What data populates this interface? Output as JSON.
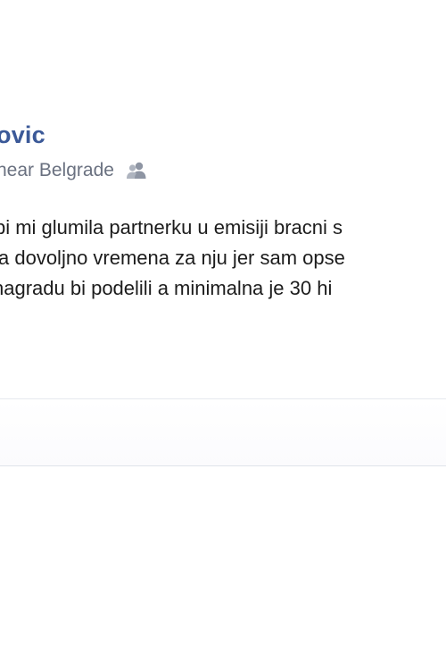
{
  "post": {
    "author_name": "ovic",
    "location": "near Belgrade",
    "audience_icon": "friends-icon",
    "body_lines": [
      "bi mi glumila partnerku u emisiji bracni s",
      "a dovoljno vremena za nju jer sam opse",
      " nagradu bi podelili a minimalna je 30 hi"
    ]
  },
  "colors": {
    "author_link": "#3b5998",
    "meta_text": "#6a7180",
    "body_text": "#1c1c1c",
    "divider": "#e6e9ef"
  }
}
